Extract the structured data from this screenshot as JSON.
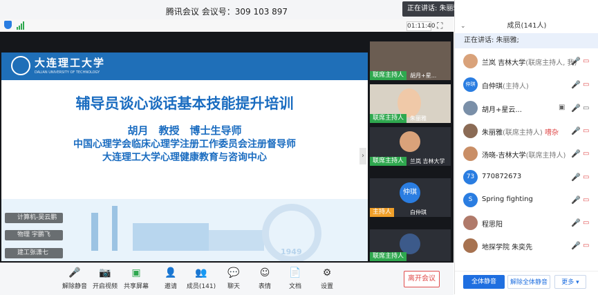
{
  "window": {
    "title": "腾讯会议 会议号：309 103 897",
    "timer": "01:11:40"
  },
  "toast": {
    "text": "正在讲话: 朱丽雅;"
  },
  "slide": {
    "university_cn": "大连理工大学",
    "university_en": "DALIAN UNIVERSITY OF TECHNOLOGY",
    "title": "辅导员谈心谈话基本技能提升培训",
    "lines": [
      "胡月　教授　博士生导师",
      "中国心理学会临床心理学注册工作委员会注册督导师",
      "大连理工大学心理健康教育与咨询中心"
    ],
    "seal_year": "1949"
  },
  "captions": [
    "计算机-吴云鹏",
    "物理 宇鹏飞",
    "建工张潇七"
  ],
  "tiles": [
    {
      "role": "联席主持人",
      "name": "胡月+星..."
    },
    {
      "role": "联席主持人",
      "name": "朱丽雅"
    },
    {
      "role": "联席主持人",
      "name": "兰岚 吉林大学"
    },
    {
      "role": "主持人",
      "name": "白仲琪",
      "initials": "仲琪"
    },
    {
      "role": "联席主持人",
      "name": ""
    }
  ],
  "toolbar": [
    {
      "label": "解除静音",
      "icon": "mic-muted-icon",
      "glyph": "🎤"
    },
    {
      "label": "开启视频",
      "icon": "camera-off-icon",
      "glyph": "📷"
    },
    {
      "label": "共享屏幕",
      "icon": "share-screen-icon",
      "glyph": "▣"
    },
    {
      "label": "邀请",
      "icon": "invite-icon",
      "glyph": "👤"
    },
    {
      "label": "成员(141)",
      "icon": "members-icon",
      "glyph": "👥"
    },
    {
      "label": "聊天",
      "icon": "chat-icon",
      "glyph": "💬"
    },
    {
      "label": "表情",
      "icon": "emoji-icon",
      "glyph": "☺"
    },
    {
      "label": "文档",
      "icon": "document-icon",
      "glyph": "📄"
    },
    {
      "label": "设置",
      "icon": "settings-icon",
      "glyph": "⚙"
    }
  ],
  "leave_label": "离开会议",
  "panel": {
    "header": "成员(141人)",
    "speaking": "正在讲话: 朱丽雅;",
    "members": [
      {
        "name": "兰岚 吉林大学",
        "tag": "(联席主持人, 我)",
        "avatar_color": "#d9a27a",
        "avatar_text": "",
        "mic": "muted"
      },
      {
        "name": "白仲琪",
        "tag": "(主持人)",
        "avatar_color": "#2a7de1",
        "avatar_text": "仲琪",
        "mic": "muted"
      },
      {
        "name": "胡月+星云...",
        "tag": "",
        "avatar_color": "#7a8fa8",
        "avatar_text": "",
        "mic": "on"
      },
      {
        "name": "朱丽雅",
        "tag": "(联席主持人)",
        "extra": "嘈杂",
        "avatar_color": "#8b6b55",
        "avatar_text": "",
        "mic": "speaking"
      },
      {
        "name": "汤晓-吉林大学",
        "tag": "(联席主持人)",
        "avatar_color": "#c98e66",
        "avatar_text": "",
        "mic": "muted"
      },
      {
        "name": "770872673",
        "tag": "",
        "avatar_color": "#2a7de1",
        "avatar_text": "73",
        "mic": "muted"
      },
      {
        "name": "Spring fighting",
        "tag": "",
        "avatar_color": "#2a7de1",
        "avatar_text": "S",
        "mic": "muted"
      },
      {
        "name": "程思阳",
        "tag": "",
        "avatar_color": "#b07a6a",
        "avatar_text": "",
        "mic": "muted"
      },
      {
        "name": "地探学院 朱奕先",
        "tag": "",
        "avatar_color": "#a77250",
        "avatar_text": "",
        "mic": "muted"
      }
    ],
    "footer": {
      "mute_all": "全体静音",
      "unmute_all": "解除全体静音",
      "more": "更多"
    }
  },
  "colors": {
    "accent": "#1a6cc0",
    "host_tag": "#2fa84f",
    "muted": "#e04b4b",
    "toolbar_bg": "#f5f6f8"
  }
}
